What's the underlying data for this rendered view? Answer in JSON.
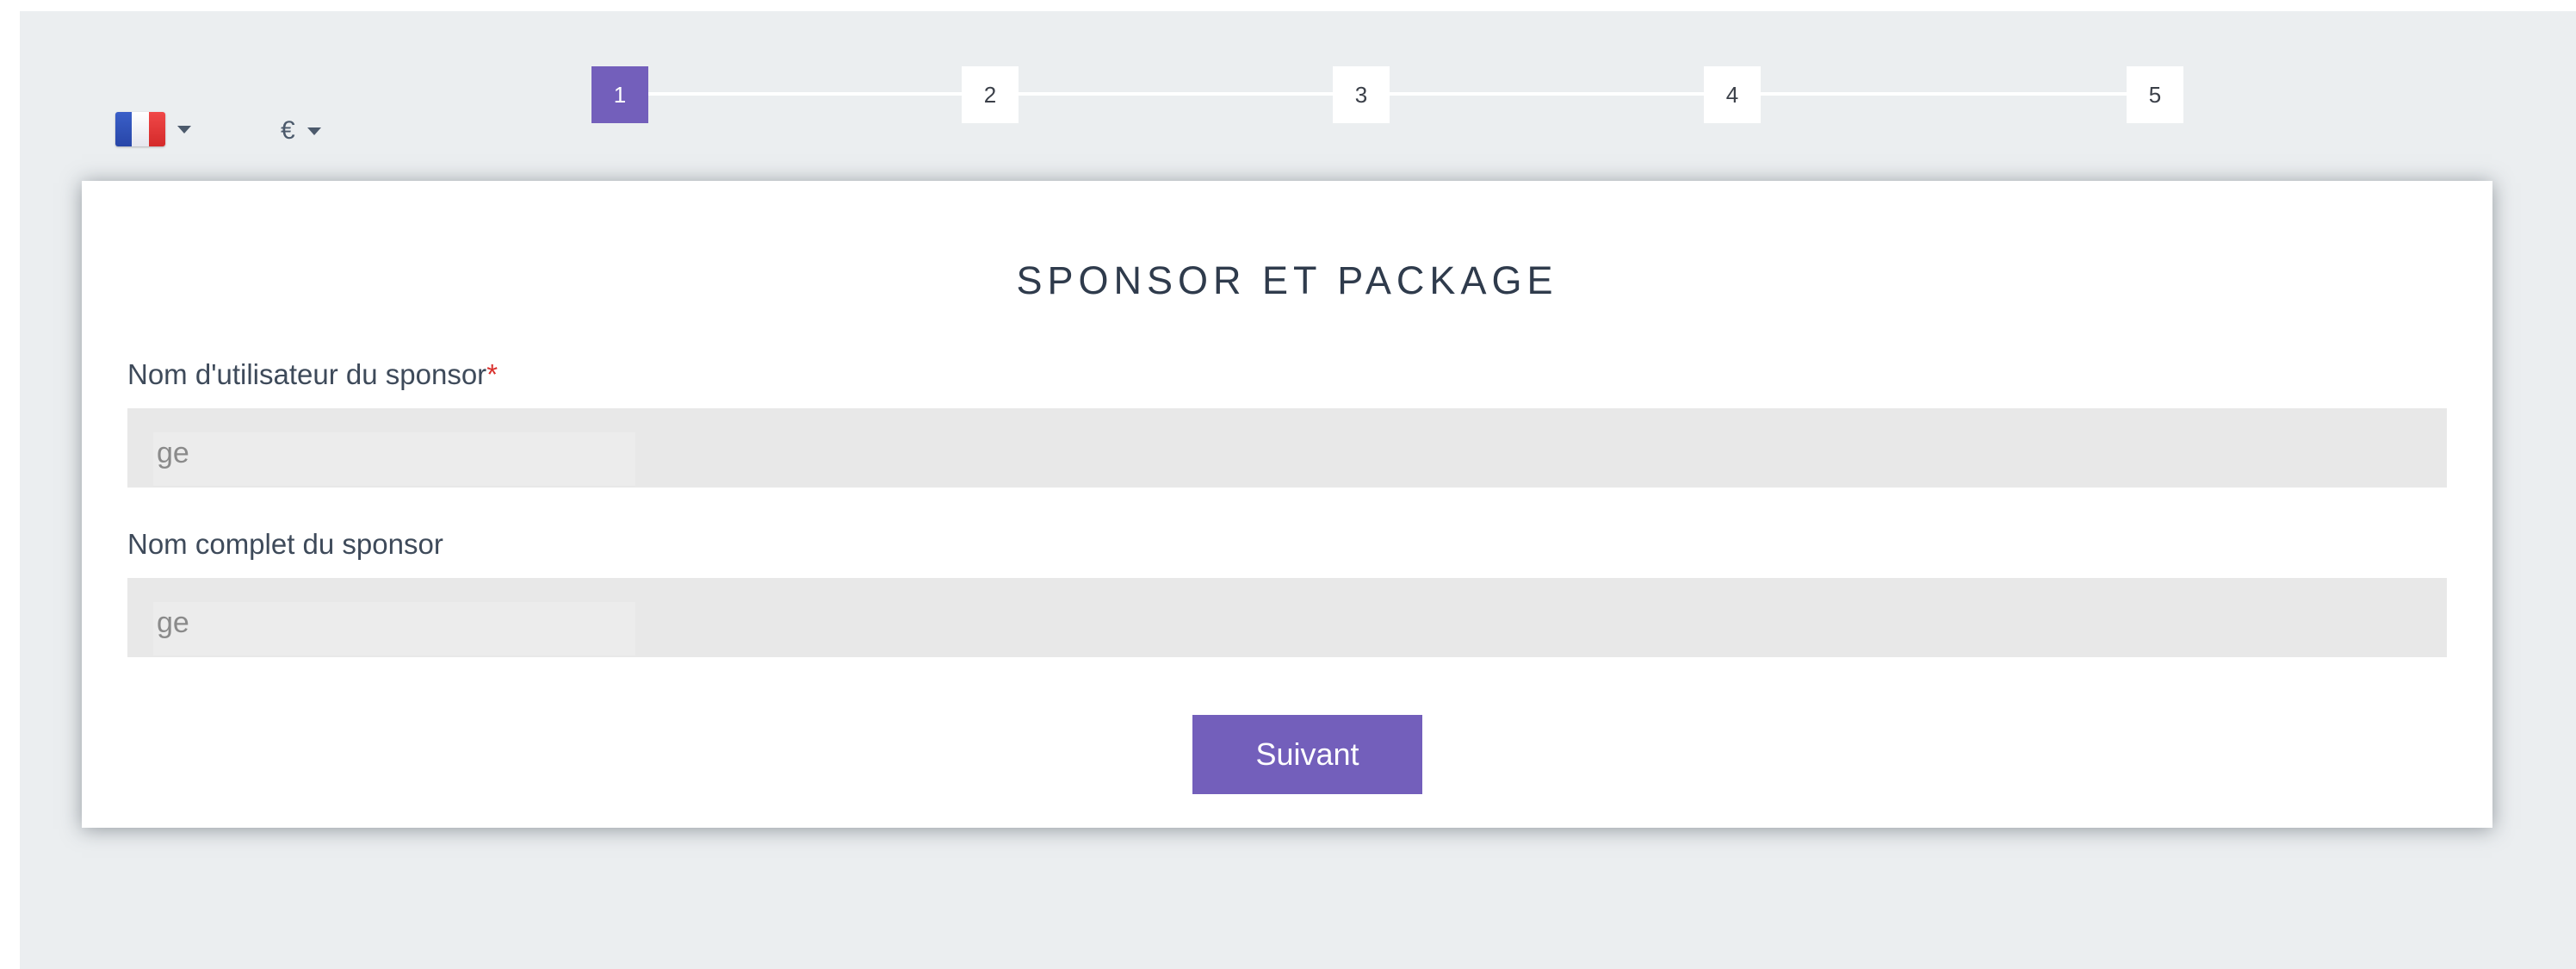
{
  "header": {
    "language": {
      "icon": "france-flag-icon"
    },
    "currency": {
      "symbol": "€"
    }
  },
  "stepper": {
    "steps": [
      "1",
      "2",
      "3",
      "4",
      "5"
    ],
    "active_step": "1"
  },
  "form": {
    "title": "SPONSOR ET PACKAGE",
    "sponsor_username": {
      "label": "Nom d'utilisateur du sponsor",
      "required_mark": "*",
      "value": "ge"
    },
    "sponsor_fullname": {
      "label": "Nom complet du sponsor",
      "value": "ge"
    },
    "next_label": "Suivant"
  },
  "colors": {
    "accent": "#735fbb",
    "page_background": "#ebeef0",
    "required": "#d9302c"
  }
}
